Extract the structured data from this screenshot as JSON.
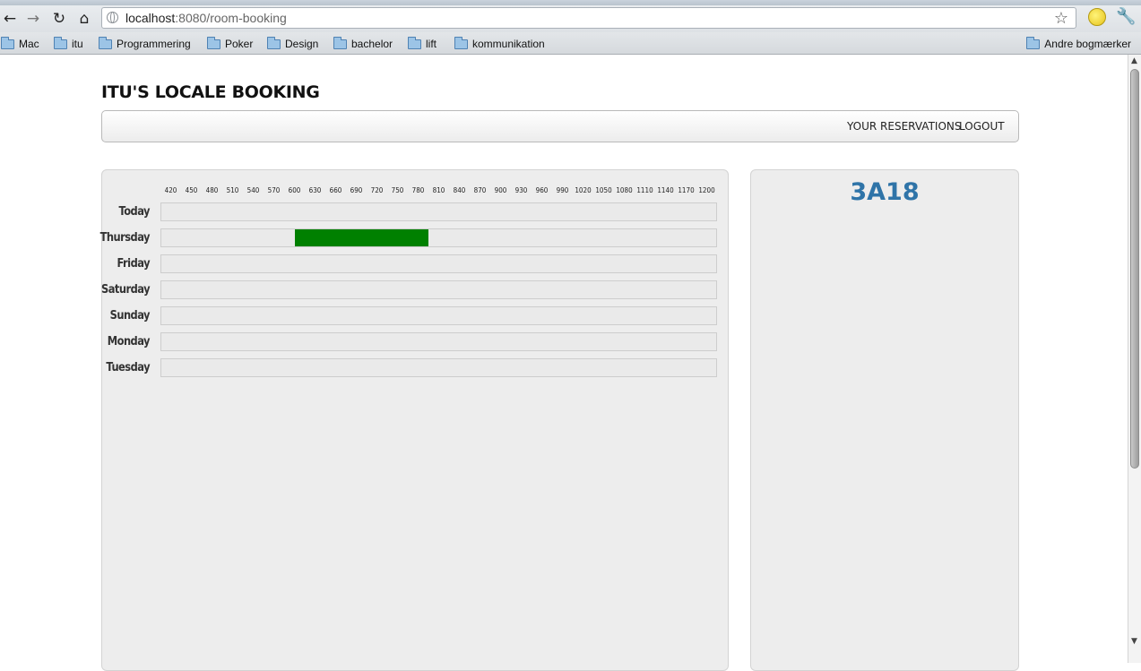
{
  "browser": {
    "url_host": "localhost",
    "url_rest": ":8080/room-booking",
    "nav_icons": [
      "back-arrow-icon",
      "forward-arrow-icon",
      "reload-icon",
      "home-icon"
    ],
    "bookmarks": [
      "Mac",
      "itu",
      "Programmering",
      "Poker",
      "Design",
      "bachelor",
      "lift",
      "kommunikation"
    ],
    "other_bookmarks": "Andre bogmærker"
  },
  "page": {
    "title": "ITU'S LOCALE BOOKING",
    "nav": {
      "reservations": "YOUR RESERVATIONS",
      "logout": "LOGOUT"
    },
    "room": "3A18"
  },
  "schedule": {
    "start": 420,
    "end": 1200,
    "ticks": [
      420,
      450,
      480,
      510,
      540,
      570,
      600,
      630,
      660,
      690,
      720,
      750,
      780,
      810,
      840,
      870,
      900,
      930,
      960,
      990,
      1020,
      1050,
      1080,
      1110,
      1140,
      1170,
      1200
    ],
    "days": [
      "Today",
      "Thursday",
      "Friday",
      "Saturday",
      "Sunday",
      "Monday",
      "Tuesday"
    ],
    "bookings": [
      {
        "day": "Thursday",
        "start": 600,
        "end": 795
      }
    ],
    "colors": {
      "booking": "#008000",
      "room": "#2f74a8"
    }
  }
}
